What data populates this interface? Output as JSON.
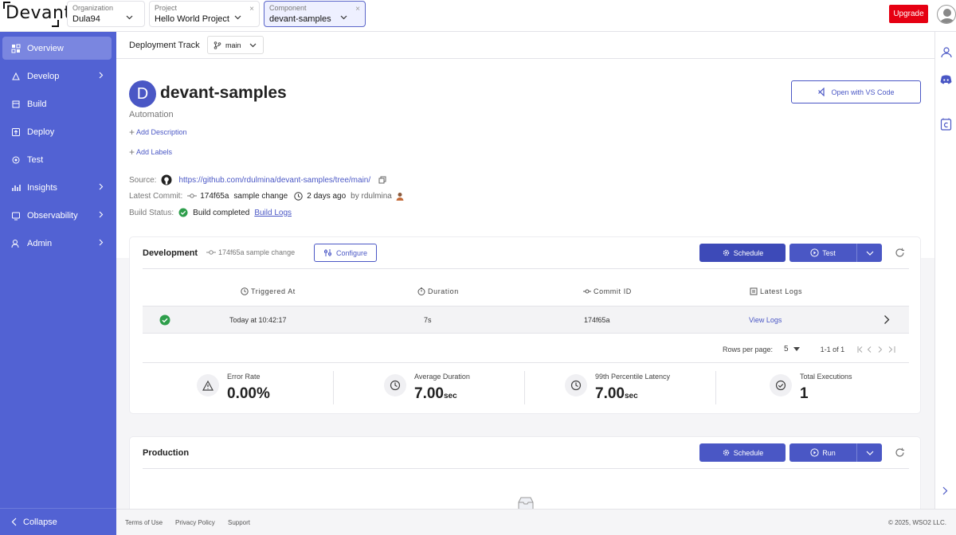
{
  "brand": {
    "logo_text": "Devant"
  },
  "topbar": {
    "organization": {
      "label": "Organization",
      "value": "Dula94"
    },
    "project": {
      "label": "Project",
      "value": "Hello World Project",
      "close": "×"
    },
    "component": {
      "label": "Component",
      "value": "devant-samples",
      "close": "×"
    },
    "upgrade_label": "Upgrade",
    "upgrade_color": "#e60012"
  },
  "sidebar": {
    "bg_color": "#5262d3",
    "items": [
      {
        "label": "Overview",
        "icon": "overview-icon",
        "active": true
      },
      {
        "label": "Develop",
        "icon": "develop-icon",
        "submenu": true
      },
      {
        "label": "Build",
        "icon": "build-icon"
      },
      {
        "label": "Deploy",
        "icon": "deploy-icon"
      },
      {
        "label": "Test",
        "icon": "test-icon"
      },
      {
        "label": "Insights",
        "icon": "insights-icon",
        "submenu": true
      },
      {
        "label": "Observability",
        "icon": "observability-icon",
        "submenu": true
      },
      {
        "label": "Admin",
        "icon": "admin-icon",
        "submenu": true
      }
    ],
    "collapse_label": "Collapse"
  },
  "track": {
    "label": "Deployment Track",
    "branch": "main"
  },
  "component": {
    "avatar_letter": "D",
    "name": "devant-samples",
    "type": "Automation",
    "add_description": "Add Description",
    "add_labels": "Add Labels",
    "vscode_label": "Open with VS Code",
    "source_key": "Source:",
    "source_url": "https://github.com/rdulmina/devant-samples/tree/main/",
    "commit_key": "Latest Commit:",
    "commit_id": "174f65a",
    "commit_msg": "sample change",
    "commit_time": "2 days ago",
    "commit_author": "by rdulmina",
    "build_key": "Build Status:",
    "build_status": "Build completed",
    "build_logs": "Build Logs"
  },
  "development": {
    "title": "Development",
    "commit": "174f65a sample change",
    "configure": "Configure",
    "schedule": "Schedule",
    "test": "Test",
    "columns": [
      "Triggered At",
      "Duration",
      "Commit ID",
      "Latest Logs"
    ],
    "row": {
      "triggered": "Today at 10:42:17",
      "duration": "7s",
      "commit": "174f65a",
      "logs": "View Logs"
    },
    "pager": {
      "rows_label": "Rows per page:",
      "rows_value": "5",
      "range": "1-1 of 1"
    },
    "stats": [
      {
        "label": "Error Rate",
        "value": "0.00%",
        "unit": ""
      },
      {
        "label": "Average Duration",
        "value": "7.00",
        "unit": "sec"
      },
      {
        "label": "99th Percentile Latency",
        "value": "7.00",
        "unit": "sec"
      },
      {
        "label": "Total Executions",
        "value": "1",
        "unit": ""
      }
    ]
  },
  "production": {
    "title": "Production",
    "schedule": "Schedule",
    "run": "Run"
  },
  "footer": {
    "links": [
      "Terms of Use",
      "Privacy Policy",
      "Support"
    ],
    "copyright": "© 2025, WSO2 LLC."
  }
}
